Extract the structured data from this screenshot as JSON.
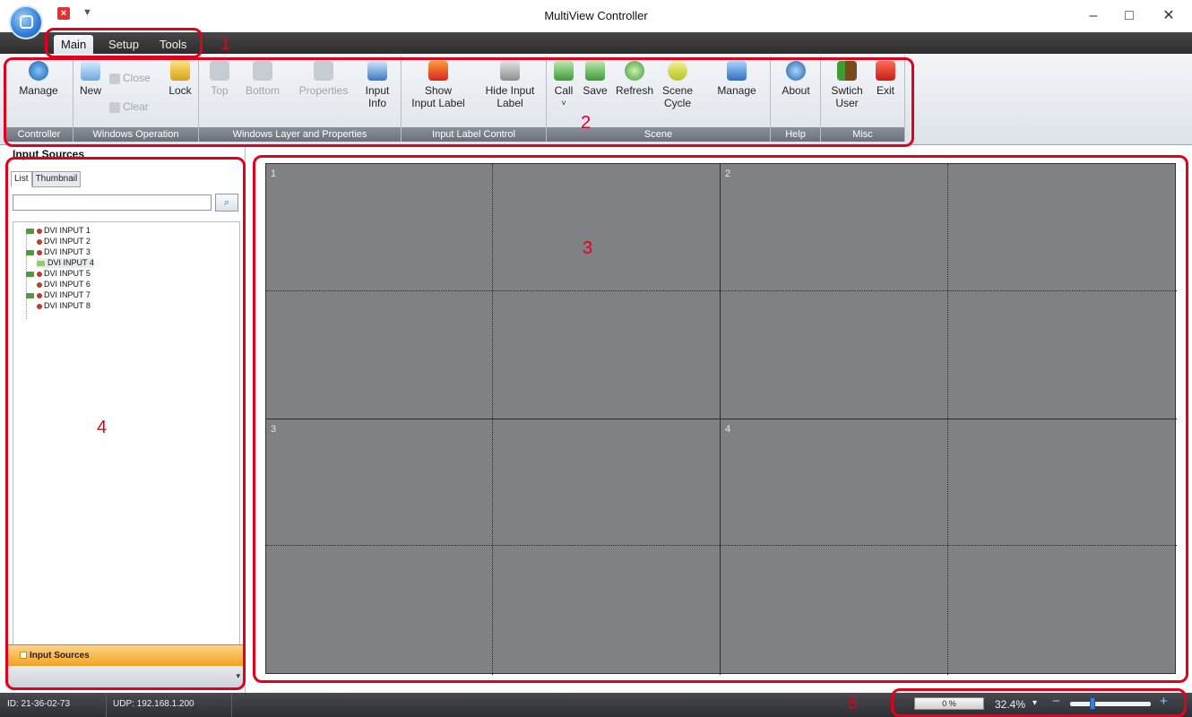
{
  "window": {
    "title": "MultiView Controller",
    "minimize": "–",
    "maximize": "□",
    "close": "✕"
  },
  "quick_access": {
    "close_glyph": "×",
    "dropdown_glyph": "▼"
  },
  "menu_tabs": {
    "main": "Main",
    "setup": "Setup",
    "tools": "Tools",
    "active": "Main"
  },
  "ribbon": {
    "controller": {
      "group_label": "Controller",
      "manage": "Manage"
    },
    "windows_operation": {
      "group_label": "Windows Operation",
      "new": "New",
      "close": "Close",
      "clear": "Clear",
      "lock": "Lock"
    },
    "windows_layer": {
      "group_label": "Windows Layer and Properties",
      "top": "Top",
      "bottom": "Bottom",
      "properties": "Properties",
      "input_info_1": "Input",
      "input_info_2": "Info"
    },
    "input_label": {
      "group_label": "Input Label Control",
      "show_1": "Show",
      "show_2": "Input Label",
      "hide_1": "Hide Input",
      "hide_2": "Label"
    },
    "scene": {
      "group_label": "Scene",
      "call": "Call",
      "call_arrow": "˅",
      "save": "Save",
      "refresh": "Refresh",
      "scene_cycle_1": "Scene",
      "scene_cycle_2": "Cycle",
      "manage": "Manage"
    },
    "help": {
      "group_label": "Help",
      "about": "About"
    },
    "misc": {
      "group_label": "Misc",
      "switch_1": "Swtich",
      "switch_2": "User",
      "exit": "Exit"
    }
  },
  "input_sources": {
    "title": "Input Sources",
    "tabs": {
      "list": "List",
      "thumbnail": "Thumbnail"
    },
    "search_placeholder": "",
    "search_glyph": "⌕",
    "items": [
      {
        "label": "DVI INPUT 1",
        "connected": true
      },
      {
        "label": "DVI INPUT 2",
        "connected": false
      },
      {
        "label": "DVI INPUT 3",
        "connected": true
      },
      {
        "label": "DVI INPUT 4",
        "connected": true,
        "selected": true
      },
      {
        "label": "DVI INPUT 5",
        "connected": true
      },
      {
        "label": "DVI INPUT 6",
        "connected": false
      },
      {
        "label": "DVI INPUT 7",
        "connected": true
      },
      {
        "label": "DVI INPUT 8",
        "connected": false
      }
    ],
    "bottom_tab": "Input Sources",
    "bottom_chevron": "▾"
  },
  "wall": {
    "screens": [
      {
        "label": "1"
      },
      {
        "label": "2"
      },
      {
        "label": "3"
      },
      {
        "label": "4"
      }
    ]
  },
  "annotations": [
    "1",
    "2",
    "3",
    "4",
    "5"
  ],
  "status": {
    "id": "ID: 21-36-02-73",
    "udp": "UDP: 192.168.1.200",
    "progress": "0 %",
    "zoom": "32.4%",
    "zoom_dropdown": "▾",
    "zoom_minus": "−",
    "zoom_plus": "+"
  },
  "colors": {
    "annotation": "#e3001b",
    "wall": "#808184",
    "accent": "#3b7fd6"
  }
}
